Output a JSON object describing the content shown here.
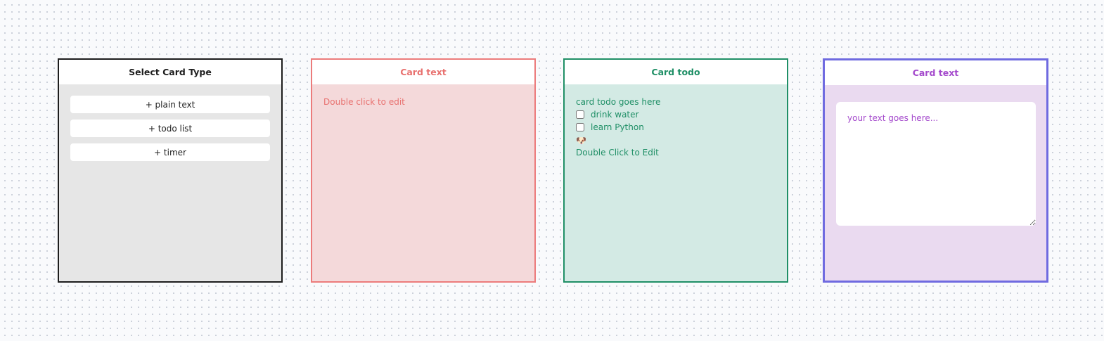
{
  "cards": {
    "select": {
      "title": "Select Card Type",
      "options": [
        "+ plain text",
        "+ todo list",
        "+ timer"
      ]
    },
    "text_card": {
      "title": "Card text",
      "hint": "Double click to edit",
      "colors": {
        "border": "#ec7b7b",
        "background": "#f4d9da",
        "text": "#e8716f"
      }
    },
    "todo_card": {
      "title": "Card todo",
      "heading": "card todo goes here",
      "items": [
        {
          "label": "drink water",
          "checked": false
        },
        {
          "label": "learn Python",
          "checked": false
        }
      ],
      "emoji": "🐶",
      "hint": "Double Click to Edit",
      "colors": {
        "border": "#1f8f66",
        "background": "#d3eae4",
        "text": "#1f8f66"
      }
    },
    "edit_card": {
      "title": "Card text",
      "value": "your text goes here...",
      "colors": {
        "border": "#6f6ae0",
        "background": "#eadaf0",
        "text": "#a449cc"
      }
    }
  }
}
